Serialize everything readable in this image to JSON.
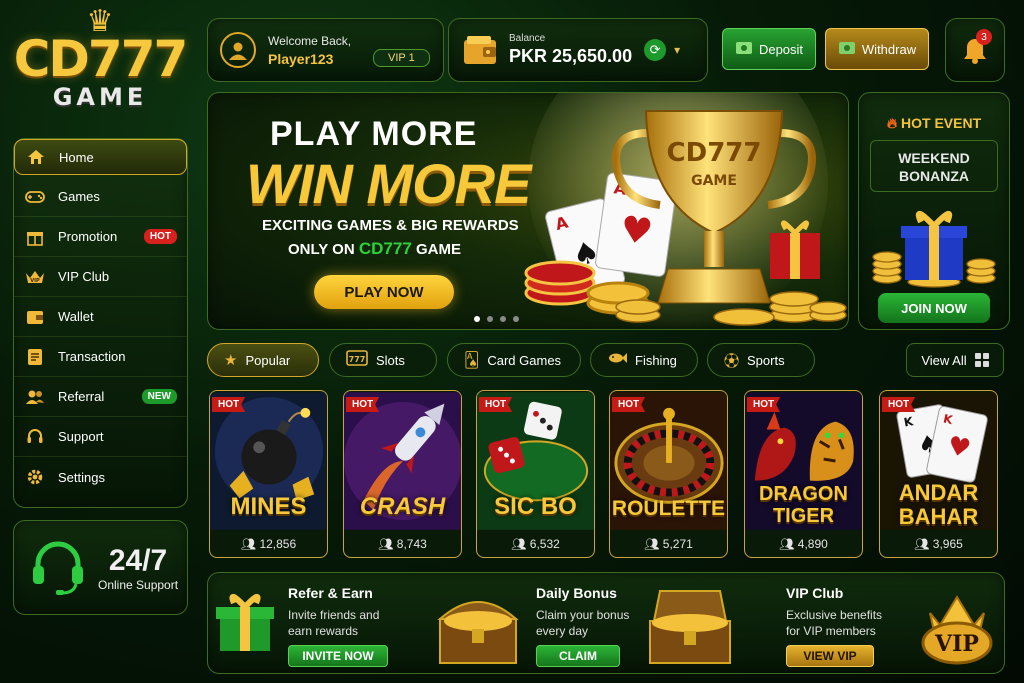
{
  "brand": {
    "name": "CD777",
    "sub": "GAME"
  },
  "sidebar": {
    "items": [
      {
        "label": "Home",
        "icon": "home-icon"
      },
      {
        "label": "Games",
        "icon": "gamepad-icon"
      },
      {
        "label": "Promotion",
        "icon": "gift-icon",
        "badge": "HOT"
      },
      {
        "label": "VIP Club",
        "icon": "crown-icon"
      },
      {
        "label": "Wallet",
        "icon": "wallet-icon"
      },
      {
        "label": "Transaction",
        "icon": "document-icon"
      },
      {
        "label": "Referral",
        "icon": "users-icon",
        "badge": "NEW"
      },
      {
        "label": "Support",
        "icon": "headset-icon"
      },
      {
        "label": "Settings",
        "icon": "gear-icon"
      }
    ]
  },
  "support": {
    "hours": "24/7",
    "label": "Online Support"
  },
  "user": {
    "greeting": "Welcome Back,",
    "name": "Player123",
    "vip": "VIP 1"
  },
  "balance": {
    "label": "Balance",
    "value": "PKR 25,650.00"
  },
  "actions": {
    "deposit": "Deposit",
    "withdraw": "Withdraw",
    "notifications": "3"
  },
  "hero": {
    "line1": "PLAY MORE",
    "line2": "WIN MORE",
    "line3": "EXCITING GAMES & BIG REWARDS",
    "line4_pre": "ONLY ON ",
    "line4_brand": "CD777",
    "line4_post": " GAME",
    "cta": "PLAY NOW",
    "trophy_brand": "CD777",
    "trophy_sub": "GAME",
    "slide_count": 4,
    "active_slide": 1
  },
  "event": {
    "title": "HOT EVENT",
    "name_line1": "WEEKEND",
    "name_line2": "BONANZA",
    "cta": "JOIN NOW"
  },
  "tabs": [
    {
      "label": "Popular",
      "icon": "star-icon"
    },
    {
      "label": "Slots",
      "icon": "slot-machine-icon"
    },
    {
      "label": "Card Games",
      "icon": "cards-icon"
    },
    {
      "label": "Fishing",
      "icon": "fish-icon"
    },
    {
      "label": "Sports",
      "icon": "soccer-ball-icon"
    }
  ],
  "view_all": "View All",
  "games": [
    {
      "name1": "MINES",
      "name2": "",
      "players": "12,856",
      "badge": "HOT"
    },
    {
      "name1": "CRASH",
      "name2": "",
      "players": "8,743",
      "badge": "HOT"
    },
    {
      "name1": "SIC BO",
      "name2": "",
      "players": "6,532",
      "badge": "HOT"
    },
    {
      "name1": "ROULETTE",
      "name2": "",
      "players": "5,271",
      "badge": "HOT"
    },
    {
      "name1": "DRAGON",
      "name2": "TIGER",
      "players": "4,890",
      "badge": "HOT"
    },
    {
      "name1": "ANDAR",
      "name2": "BAHAR",
      "players": "3,965",
      "badge": "HOT"
    }
  ],
  "promos": [
    {
      "title": "Refer & Earn",
      "desc1": "Invite friends and",
      "desc2": "earn rewards",
      "cta": "INVITE NOW"
    },
    {
      "title": "Daily Bonus",
      "desc1": "Claim your bonus",
      "desc2": "every day",
      "cta": "CLAIM"
    },
    {
      "title": "VIP Club",
      "desc1": "Exclusive benefits",
      "desc2": "for VIP members",
      "cta": "VIEW VIP",
      "emblem": "VIP"
    }
  ]
}
